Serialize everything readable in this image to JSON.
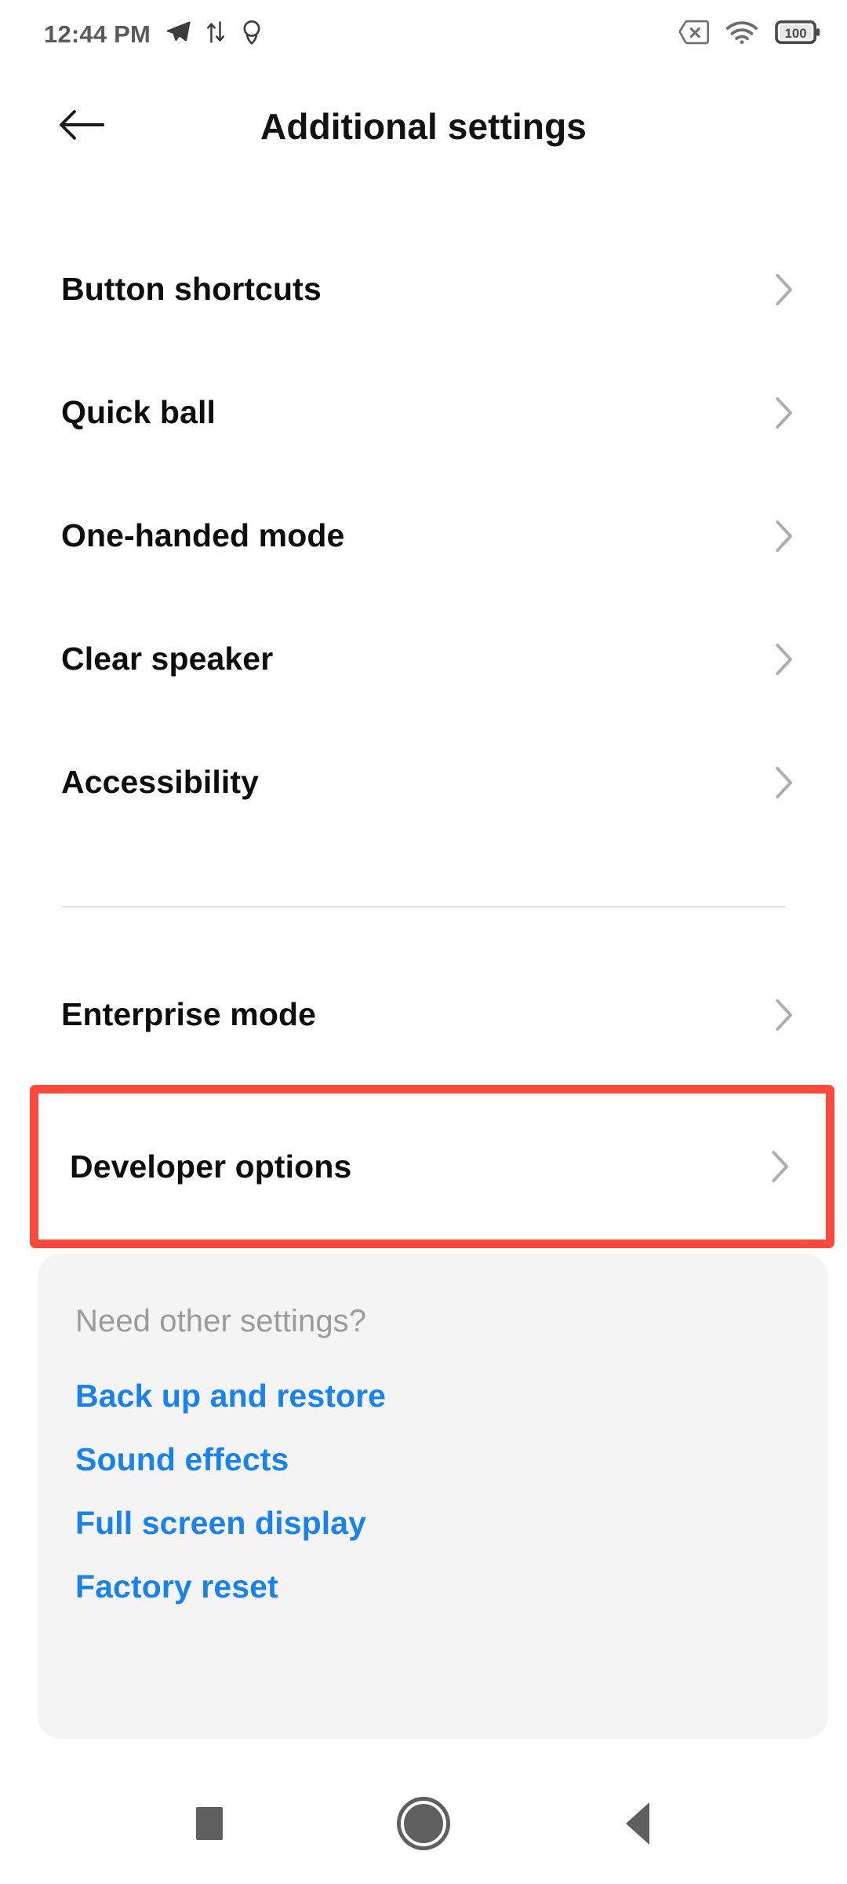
{
  "status_bar": {
    "clock": "12:44 PM",
    "battery_level": "100",
    "left_icons": [
      "telegram-send-icon",
      "data-transfer-icon",
      "location-pin-icon"
    ],
    "right_icons": [
      "sim-card-no-service-icon",
      "wifi-icon",
      "battery-icon"
    ]
  },
  "app_bar": {
    "back_icon": "back-arrow-icon",
    "title": "Additional settings"
  },
  "settings": {
    "group_one": [
      {
        "label": "Button shortcuts"
      },
      {
        "label": "Quick ball"
      },
      {
        "label": "One-handed mode"
      },
      {
        "label": "Clear speaker"
      },
      {
        "label": "Accessibility"
      }
    ],
    "group_two": [
      {
        "label": "Enterprise mode"
      }
    ],
    "highlighted": {
      "label": "Developer options"
    },
    "chevron_icon": "chevron-right-icon",
    "highlight_color": "#fb4a3c"
  },
  "suggestions": {
    "title": "Need other settings?",
    "link_color": "#1a82e8",
    "links": [
      {
        "label": "Back up and restore"
      },
      {
        "label": "Sound effects"
      },
      {
        "label": "Full screen display"
      },
      {
        "label": "Factory reset"
      }
    ]
  },
  "nav_bar": {
    "recents_icon": "square-recents-icon",
    "home_icon": "circle-home-icon",
    "back_icon": "triangle-back-icon"
  }
}
